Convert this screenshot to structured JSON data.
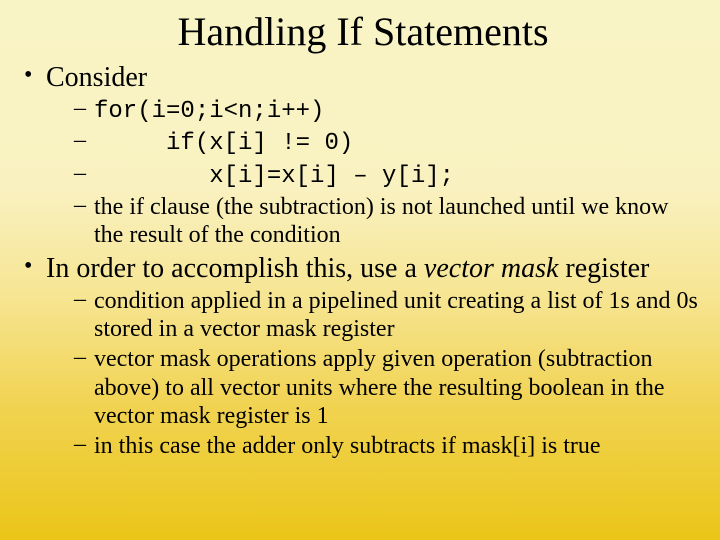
{
  "title": "Handling If Statements",
  "bullets": {
    "b1": "Consider",
    "b1_subs": {
      "c1": "for(i=0;i<n;i++)",
      "c2": "     if(x[i] != 0)",
      "c3": "        x[i]=x[i] – y[i];",
      "c4": "the if clause (the subtraction) is not launched until we know the result of the condition"
    },
    "b2_pre": "In order to accomplish this, use a ",
    "b2_em": "vector mask",
    "b2_post": " register",
    "b2_subs": {
      "s1": "condition applied in a pipelined unit creating a list of 1s and 0s stored in a vector mask register",
      "s2": "vector mask operations apply given operation (subtraction above) to all vector units where the resulting boolean in the vector mask register is 1",
      "s3": "in this case the adder only subtracts if mask[i] is true"
    }
  }
}
